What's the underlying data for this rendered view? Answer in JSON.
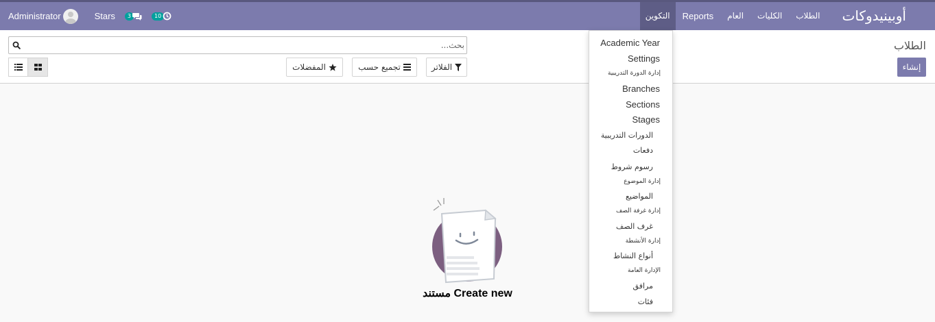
{
  "navbar": {
    "brand": "أوبينيدوكات",
    "menus": [
      "الطلاب",
      "الكليات",
      "العام",
      "Reports",
      "التكوين"
    ],
    "active_menu": "التكوين",
    "user_name": "Administrator",
    "stars_label": "Stars",
    "messages_count": "3",
    "activities_count": "10",
    "accent_color": "#7c7bad"
  },
  "control_panel": {
    "title": "الطلاب",
    "create_label": "إنشاء",
    "search_placeholder": "بحث...",
    "filters_label": "الفلاتر",
    "group_by_label": "تجميع حسب",
    "favorites_label": "المفضلات"
  },
  "empty_state": {
    "title": "Create new مستند"
  },
  "dropdown": {
    "items": [
      "Academic Year",
      "Settings",
      "إدارة الدورة التدريبية",
      "Branches",
      "Sections",
      "Stages",
      "الدورات التدريبية",
      "دفعات",
      "رسوم شروط",
      "إدارة الموضوع",
      "المواضيع",
      "إدارة غرفة الصف",
      "غرف الصف",
      "إدارة الأنشطة",
      "أنواع النشاط",
      "الإدارة العامة",
      "مرافق",
      "فئات"
    ]
  }
}
